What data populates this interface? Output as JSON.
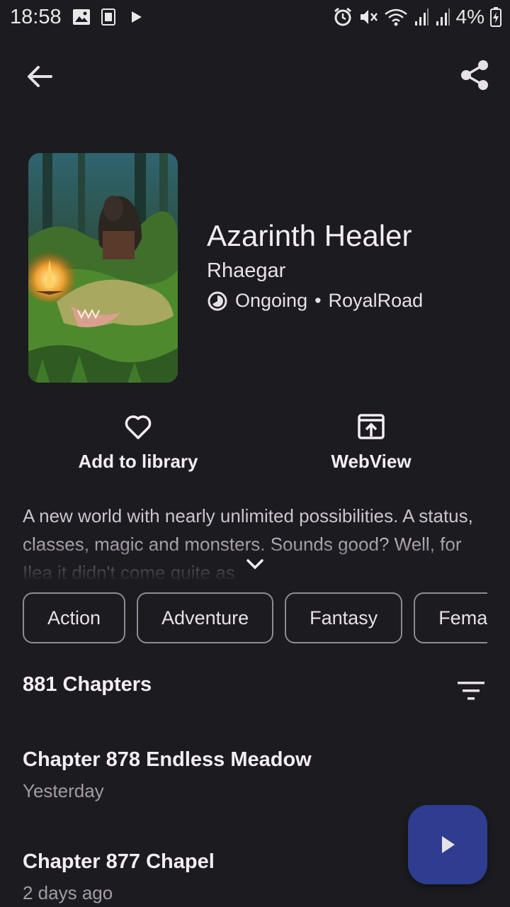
{
  "status_bar": {
    "time": "18:58",
    "battery": "4%",
    "icons": [
      "image-icon",
      "keyboard-icon",
      "play-icon",
      "alarm-icon",
      "mute-icon",
      "wifi-icon",
      "signal-icon",
      "signal-icon",
      "battery-charging-icon"
    ]
  },
  "novel": {
    "title": "Azarinth Healer",
    "author": "Rhaegar",
    "status": "Ongoing",
    "separator": "•",
    "source": "RoyalRoad",
    "summary": "A new world with nearly unlimited possibilities. A status, classes, magic and monsters. Sounds good? Well, for Ilea it didn't come quite as"
  },
  "actions": {
    "library_label": "Add to library",
    "webview_label": "WebView"
  },
  "tags": [
    "Action",
    "Adventure",
    "Fantasy",
    "Female Lead"
  ],
  "chapters": {
    "count_label": "881 Chapters",
    "items": [
      {
        "title": "Chapter 878 Endless Meadow",
        "date": "Yesterday"
      },
      {
        "title": "Chapter 877 Chapel",
        "date": "2 days ago"
      }
    ]
  },
  "colors": {
    "background": "#1c1b20",
    "fab": "#2e3d8f",
    "text": "#e6e1e6"
  }
}
